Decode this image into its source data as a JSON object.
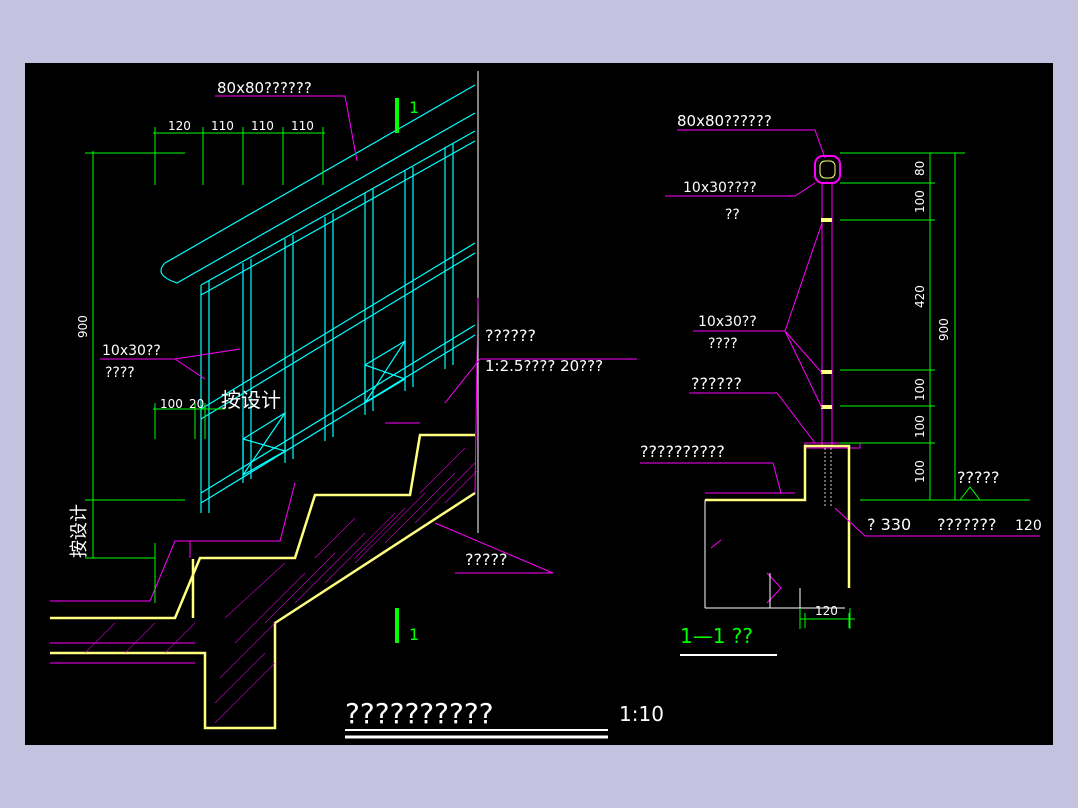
{
  "colors": {
    "background": "#c3c3df",
    "canvas": "#000000",
    "dimension": "#00ff00",
    "leader": "#ff00ff",
    "railing": "#00ffff",
    "outline": "#ffff80",
    "text": "#ffffff",
    "hatch": "#ff00ff"
  },
  "left_view": {
    "handrail_label": "80x80??????",
    "dim_top": [
      "120",
      "110",
      "110",
      "110"
    ],
    "dim_900": "900",
    "baluster_label_1": "10x30??",
    "baluster_label_2": "????",
    "dim_bottom_left": "100",
    "dim_bottom_right": "20",
    "per_design_1": "按设计",
    "per_design_2": "按设计",
    "finish_label_1": "??????",
    "finish_label_2": "1:2.5???? 20???",
    "slab_label": "?????",
    "section_mark_top": "1",
    "section_mark_bottom": "1"
  },
  "right_view": {
    "handrail_label": "80x80??????",
    "flat_bar_label_1": "10x30????",
    "flat_bar_label_2": "??",
    "baluster_label_1": "10x30??",
    "baluster_label_2": "????",
    "finish_label": "??????",
    "waterproof_label": "??????????",
    "dims_right": [
      "80",
      "100",
      "420",
      "100",
      "100",
      "100"
    ],
    "dim_total": "900",
    "floor_label": "?????",
    "anchor_label_1": "? 330",
    "anchor_label_2": "???????",
    "anchor_value": "120",
    "bottom_dim": "120",
    "section_title": "1—1 ??"
  },
  "drawing_title": "??????????",
  "scale": "1:10"
}
